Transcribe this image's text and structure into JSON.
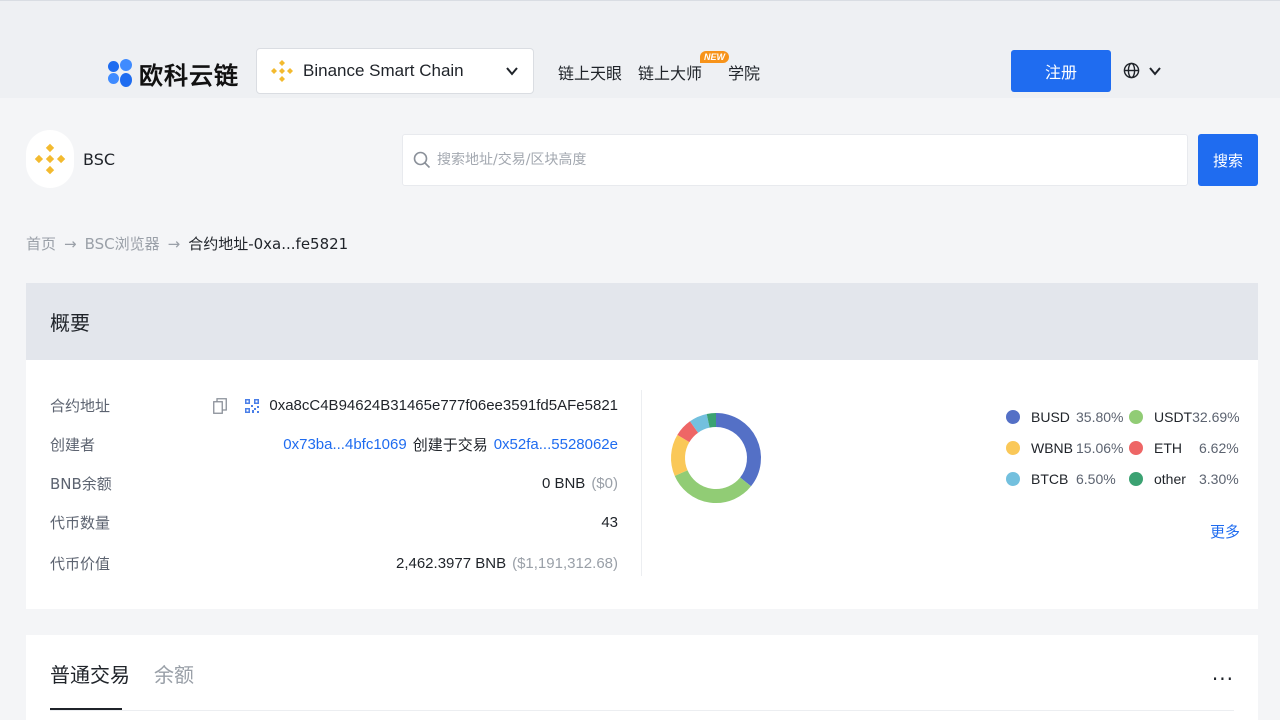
{
  "header": {
    "logo_text": "欧科云链",
    "chain_selector": {
      "value": "Binance Smart Chain",
      "icon": "bnb-icon"
    },
    "nav": [
      {
        "label": "链上天眼"
      },
      {
        "label": "链上大师",
        "badge": "NEW"
      },
      {
        "label": "学院"
      }
    ],
    "register_label": "注册",
    "language_icon": "globe-icon"
  },
  "search": {
    "coin_name": "BSC",
    "placeholder": "搜索地址/交易/区块高度",
    "button_label": "搜索"
  },
  "breadcrumb": {
    "items": [
      "首页",
      "BSC浏览器",
      "合约地址-0xa...fe5821"
    ],
    "separator": "→"
  },
  "overview": {
    "title": "概要",
    "rows": {
      "contract_address": {
        "label": "合约地址",
        "value": "0xa8cC4B94624B31465e777f06ee3591fd5AFe5821"
      },
      "creator": {
        "label": "创建者",
        "address": "0x73ba...4bfc1069",
        "mid_text": "创建于交易",
        "tx": "0x52fa...5528062e"
      },
      "bnb_balance": {
        "label": "BNB余额",
        "value": "0 BNB",
        "usd": "($0)"
      },
      "token_count": {
        "label": "代币数量",
        "value": "43"
      },
      "token_value": {
        "label": "代币价值",
        "value": "2,462.3977 BNB",
        "usd": "($1,191,312.68)"
      }
    },
    "more_label": "更多"
  },
  "chart_data": {
    "type": "pie",
    "categories": [
      "BUSD",
      "USDT",
      "WBNB",
      "ETH",
      "BTCB",
      "other"
    ],
    "values": [
      35.8,
      32.69,
      15.06,
      6.62,
      6.5,
      3.3
    ],
    "labels": [
      "35.80%",
      "32.69%",
      "15.06%",
      "6.62%",
      "6.50%",
      "3.30%"
    ],
    "colors": [
      "#5470c6",
      "#91cc75",
      "#fac858",
      "#ee6666",
      "#73c0de",
      "#3ba272"
    ],
    "legend": "right"
  },
  "tabs": [
    {
      "label": "普通交易",
      "active": true
    },
    {
      "label": "余额",
      "active": false
    }
  ],
  "tabs_more": "..."
}
